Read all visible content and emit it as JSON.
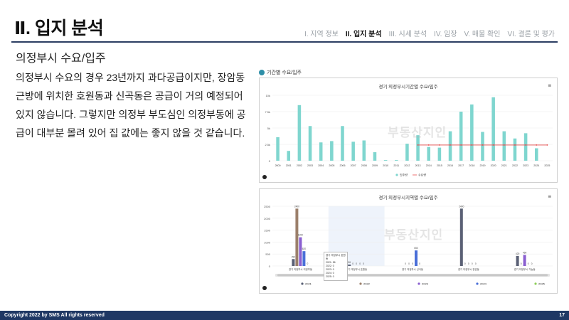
{
  "header": {
    "title": "Ⅱ. 입지 분석",
    "nav": [
      "I. 지역 정보",
      "II. 입지 분석",
      "III. 시세 분석",
      "IV. 임장",
      "V. 매물 확인",
      "VI. 결론 및 평가"
    ],
    "active_index": 1
  },
  "section_title": "의정부시 수요/입주",
  "body_text": "의정부시 수요의 경우 23년까지 과다공급이지만, 장암동 근방에 위치한 호원동과 신곡동은 공급이 거의 예정되어 있지 않습니다. 그렇지만 의정부 부도심인 의정부동에 공급이 대부분 몰려 있어 집 값에는 좋지 않을 것 같습니다.",
  "chart_tag": "기간별 수요/입주",
  "watermark": "부동산지인",
  "footer": {
    "copyright": "Copyright 2022 by SMS  All rights reserved",
    "page": "17"
  },
  "colors": {
    "bar_teal": "#7fd6cf",
    "demand_line": "#e84c4c",
    "brand_navy": "#1f3864",
    "s2021": "#5a6075",
    "s2022": "#9b7f6a",
    "s2023": "#8a5fd0",
    "s2024": "#4a6fd8",
    "s2025": "#8fce5a"
  },
  "chart_data": [
    {
      "type": "bar",
      "title": "경기 의정부시기간별 수요/입주",
      "categories": [
        "2000",
        "2001",
        "2002",
        "2003",
        "2004",
        "2005",
        "2006",
        "2007",
        "2008",
        "2009",
        "2010",
        "2011",
        "2012",
        "2013",
        "2014",
        "2015",
        "2016",
        "2017",
        "2018",
        "2019",
        "2020",
        "2021",
        "2022",
        "2023",
        "2024",
        "2025"
      ],
      "series": [
        {
          "name": "입주량",
          "values": [
            3600,
            1500,
            8500,
            5300,
            2800,
            3000,
            5300,
            2900,
            3100,
            1300,
            100,
            100,
            2600,
            3900,
            2100,
            2000,
            4500,
            7500,
            8600,
            4400,
            9700,
            4500,
            3400,
            4200,
            1900,
            0
          ]
        },
        {
          "name": "수요량",
          "values": [
            null,
            null,
            null,
            null,
            null,
            null,
            null,
            null,
            null,
            null,
            null,
            null,
            null,
            2400,
            2400,
            2400,
            2400,
            2400,
            2400,
            2400,
            2400,
            2400,
            2400,
            2400,
            2400,
            2400
          ]
        }
      ],
      "y_ticks": [
        "0",
        "2.5k",
        "5k",
        "7.5k",
        "10k"
      ],
      "ylim": [
        0,
        10000
      ],
      "legend": [
        "입주량",
        "수요량"
      ],
      "legend_position": "bottom"
    },
    {
      "type": "bar",
      "title": "경기 의정부시지역별 수요/입주",
      "categories": [
        "경기 의정부시 의정부동",
        "경기 의정부시 호원동",
        "경기 의정부시 신곡동",
        "경기 의정부시 장암동",
        "경기 의정부시 가능동"
      ],
      "series": [
        {
          "name": "2021",
          "values": [
            290,
            56,
            0,
            2400,
            420
          ]
        },
        {
          "name": "2022",
          "values": [
            2400,
            0,
            0,
            0,
            0
          ]
        },
        {
          "name": "2023",
          "values": [
            1200,
            0,
            0,
            0,
            460
          ]
        },
        {
          "name": "2024",
          "values": [
            620,
            0,
            650,
            0,
            0
          ]
        },
        {
          "name": "2025",
          "values": [
            0,
            0,
            0,
            0,
            0
          ]
        }
      ],
      "y_ticks": [
        "0",
        "500",
        "1000",
        "1500",
        "2000",
        "2500"
      ],
      "ylim": [
        0,
        2500
      ],
      "tooltip": [
        "경기 의정부시 호원동",
        "2021: 56",
        "2022: 0",
        "2023: 0",
        "2024: 0",
        "2025: 0"
      ],
      "legend": [
        "2021",
        "2022",
        "2023",
        "2024",
        "2025"
      ],
      "legend_position": "bottom"
    }
  ]
}
